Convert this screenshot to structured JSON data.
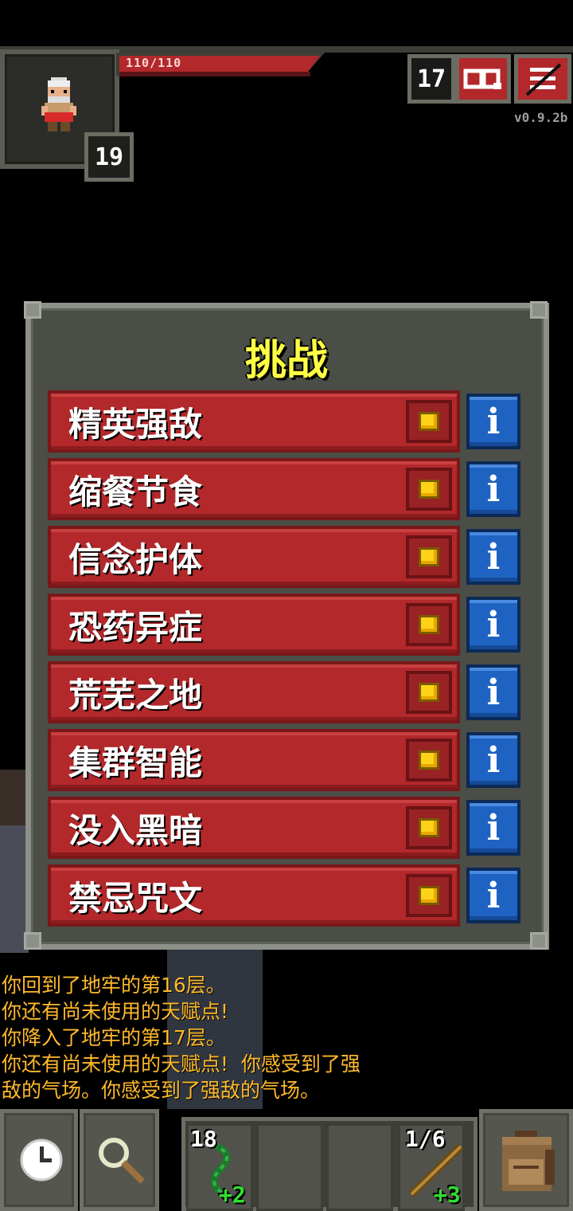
{
  "hud": {
    "hp_text": "110/110",
    "hp_fraction": 1.0,
    "hero_level": "19",
    "depth": "17",
    "version": "v0.9.2b",
    "colors": {
      "hp": "#b2282b",
      "accent": "#ffff44",
      "log": "#ffb92a"
    }
  },
  "challenges": {
    "title": "挑战",
    "items": [
      {
        "label": "精英强敌",
        "checked": false
      },
      {
        "label": "缩餐节食",
        "checked": false
      },
      {
        "label": "信念护体",
        "checked": false
      },
      {
        "label": "恐药异症",
        "checked": false
      },
      {
        "label": "荒芜之地",
        "checked": false
      },
      {
        "label": "集群智能",
        "checked": false
      },
      {
        "label": "没入黑暗",
        "checked": false
      },
      {
        "label": "禁忌咒文",
        "checked": false
      }
    ],
    "info_glyph": "i"
  },
  "log": [
    "你回到了地牢的第16层。",
    "你还有尚未使用的天赋点!",
    "你降入了地牢的第17层。",
    "你还有尚未使用的天赋点!  你感受到了强",
    "敌的气场。你感受到了强敌的气场。"
  ],
  "toolbar": {
    "wait_icon": "clock-icon",
    "search_icon": "magnifier-icon",
    "slot1": {
      "qty": "18",
      "bonus": "+2",
      "icon": "vine-icon"
    },
    "slot4": {
      "qty": "1/6",
      "bonus": "+3",
      "icon": "wand-icon"
    },
    "backpack_icon": "backpack-icon"
  }
}
